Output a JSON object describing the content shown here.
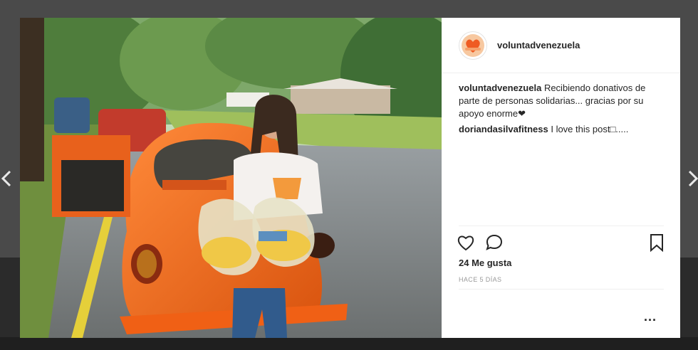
{
  "post": {
    "username": "voluntadvenezuela",
    "caption_user": "voluntadvenezuela",
    "caption_text": "Recibiendo donativos de parte de personas solidarias... gracias por su apoyo enorme❤",
    "comments": [
      {
        "user": "doriandasilvafitness",
        "text": "I love this post□....."
      }
    ],
    "likes": "24 Me gusta",
    "timestamp": "HACE 5 DÍAS",
    "more_label": "..."
  },
  "icons": {
    "prev": "chevron-left-icon",
    "next": "chevron-right-icon",
    "like": "heart-icon",
    "comment": "comment-bubble-icon",
    "save": "bookmark-icon",
    "more": "more-dots-icon"
  },
  "colors": {
    "backdrop": "#4a4a4a",
    "text": "#262626",
    "muted": "#999999",
    "car_orange": "#f26a1b"
  }
}
